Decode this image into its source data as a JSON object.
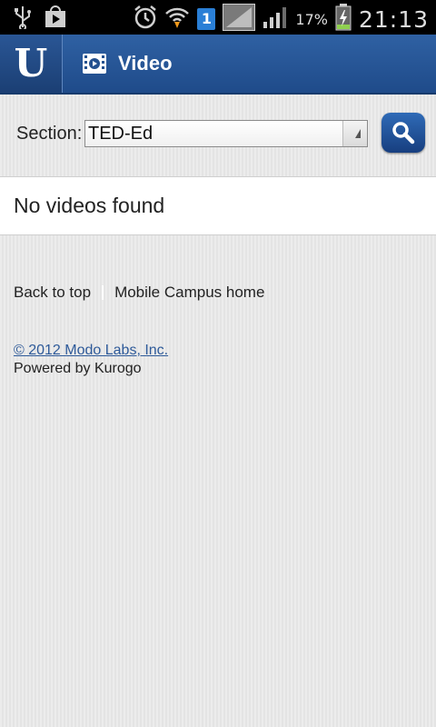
{
  "status_bar": {
    "battery_percent": "17%",
    "time": "21:13",
    "sim_label": "1",
    "icons": [
      "usb-icon",
      "play-store-icon",
      "alarm-icon",
      "wifi-icon",
      "sim-icon",
      "signal-icon",
      "signal-bars-icon",
      "battery-charging-icon"
    ]
  },
  "header": {
    "logo_letter": "U",
    "title": "Video"
  },
  "section": {
    "label": "Section:",
    "selected": "TED-Ed"
  },
  "results": {
    "message": "No videos found"
  },
  "footer": {
    "back_to_top": "Back to top",
    "campus_home": "Mobile Campus home",
    "copyright": "© 2012 Modo Labs, Inc.",
    "powered_by": "Powered by Kurogo"
  },
  "colors": {
    "header_blue": "#2f61a3",
    "link_blue": "#2e5a99"
  }
}
